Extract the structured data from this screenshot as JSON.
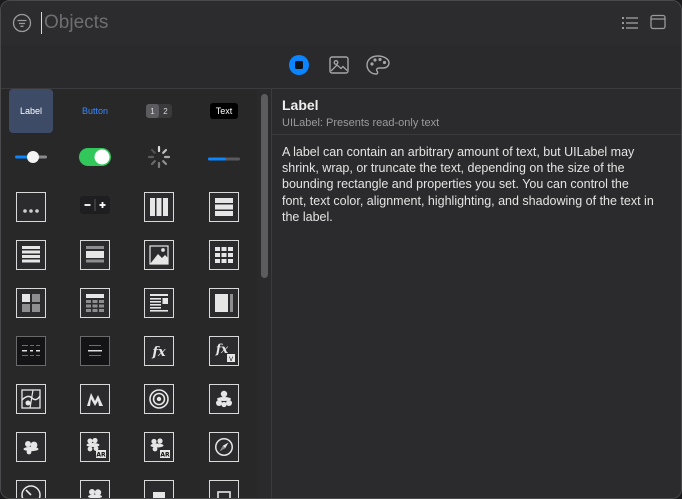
{
  "search": {
    "placeholder": "Objects",
    "value": ""
  },
  "header_icons": [
    "filter-icon",
    "list-view-icon",
    "window-icon"
  ],
  "tabs": [
    {
      "name": "objects",
      "icon": "stop-circle-icon",
      "selected": true
    },
    {
      "name": "media",
      "icon": "photo-icon",
      "selected": false
    },
    {
      "name": "colors",
      "icon": "palette-icon",
      "selected": false
    }
  ],
  "library": {
    "captions": {
      "label": "Label",
      "button": "Button",
      "seg_a": "1",
      "seg_b": "2",
      "text": "Text"
    },
    "items": [
      "label",
      "button",
      "segmented-control",
      "text-field",
      "slider",
      "switch",
      "activity-indicator",
      "progress-view",
      "page-control",
      "stepper",
      "horizontal-stack-view",
      "vertical-stack-view",
      "table-view",
      "table-view-cell",
      "image-view",
      "collection-view",
      "collection-view-cell",
      "collection-reusable-view",
      "text-view",
      "scroll-view",
      "date-picker",
      "picker-view",
      "visual-effect-view",
      "visual-effect-view-with-vibrancy",
      "map-kit-view",
      "metal-kit-view",
      "gl-kit-view",
      "scene-kit-view",
      "scenekit-view",
      "arkit-scenekit-view",
      "arkit-spritekit-view",
      "web-kit-view"
    ]
  },
  "detail": {
    "title": "Label",
    "subtitle": "UILabel: Presents read-only text",
    "description": "A label can contain an arbitrary amount of text, but UILabel may shrink, wrap, or truncate the text, depending on the size of the bounding rectangle and properties you set. You can control the font, text color, alignment, highlighting, and shadowing of the text in the label."
  },
  "colors": {
    "accent": "#0a84ff",
    "switch_on": "#32c75a",
    "selection": "#3d4b66"
  }
}
